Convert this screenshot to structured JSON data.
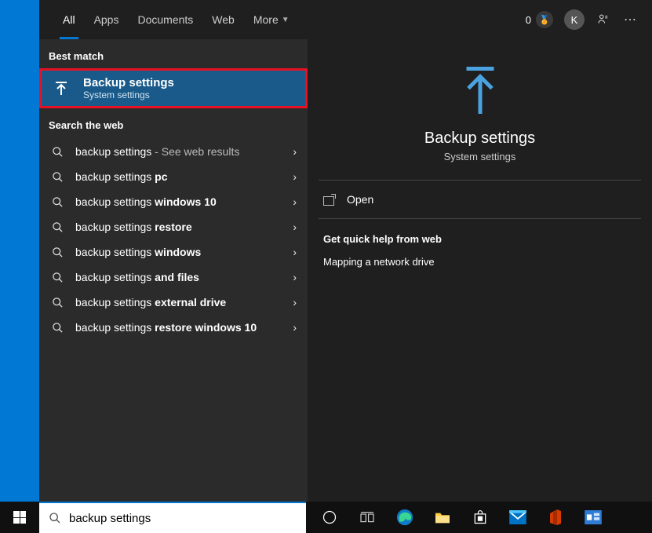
{
  "header": {
    "tabs": [
      "All",
      "Apps",
      "Documents",
      "Web",
      "More"
    ],
    "points": "0",
    "avatar_initial": "K"
  },
  "left": {
    "best_label": "Best match",
    "best_title": "Backup settings",
    "best_sub": "System settings",
    "web_label": "Search the web",
    "web_items": [
      {
        "prefix": "backup settings",
        "bold": "",
        "suffix": " - See web results"
      },
      {
        "prefix": "backup settings ",
        "bold": "pc",
        "suffix": ""
      },
      {
        "prefix": "backup settings ",
        "bold": "windows 10",
        "suffix": ""
      },
      {
        "prefix": "backup settings ",
        "bold": "restore",
        "suffix": ""
      },
      {
        "prefix": "backup settings ",
        "bold": "windows",
        "suffix": ""
      },
      {
        "prefix": "backup settings ",
        "bold": "and files",
        "suffix": ""
      },
      {
        "prefix": "backup settings ",
        "bold": "external drive",
        "suffix": ""
      },
      {
        "prefix": "backup settings ",
        "bold": "restore windows 10",
        "suffix": ""
      }
    ]
  },
  "right": {
    "title": "Backup settings",
    "sub": "System settings",
    "open_label": "Open",
    "help_header": "Get quick help from web",
    "help_links": [
      "Mapping a network drive"
    ]
  },
  "search": {
    "value": "backup settings"
  },
  "colors": {
    "accent": "#0078d4",
    "highlight": "#e81123"
  }
}
